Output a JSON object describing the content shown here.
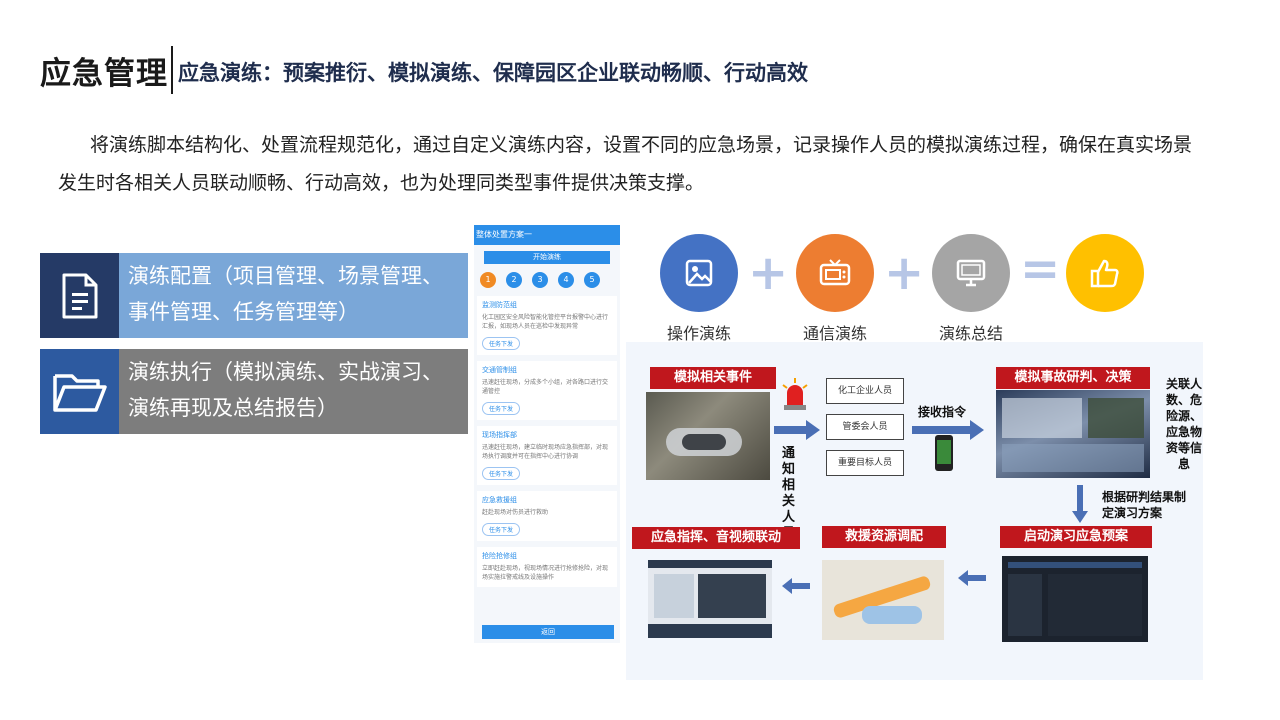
{
  "header": {
    "title": "应急管理",
    "subtitle": "应急演练：预案推衍、模拟演练、保障园区企业联动畅顺、行动高效"
  },
  "intro": "将演练脚本结构化、处置流程规范化，通过自定义演练内容，设置不同的应急场景，记录操作人员的模拟演练过程，确保在真实场景发生时各相关人员联动顺畅、行动高效，也为处理同类型事件提供决策支撑。",
  "features": [
    {
      "label": "演练配置（项目管理、场景管理、事件管理、任务管理等）",
      "icon": "document-icon"
    },
    {
      "label": "演练执行（模拟演练、实战演习、演练再现及总结报告）",
      "icon": "folder-icon"
    }
  ],
  "phone": {
    "header": "整体处置方案一",
    "start_button": "开始演练",
    "steps": [
      "1",
      "2",
      "3",
      "4",
      "5"
    ],
    "cards": [
      {
        "title": "监测防范组",
        "desc": "化工园区安全风险智能化管控平台报警中心进行汇报，如现场人员在巡检中发现异常",
        "button": "任务下发"
      },
      {
        "title": "交通管制组",
        "desc": "迅速赶往现场，分成多个小组，对各路口进行交通管控",
        "button": "任务下发"
      },
      {
        "title": "现场指挥部",
        "desc": "迅速赶往现场，建立临时现场应急指挥部，对现场执行调度并可在指挥中心进行协调",
        "button": "任务下发"
      },
      {
        "title": "应急救援组",
        "desc": "赶赴现场对伤员进行救助",
        "button": "任务下发"
      },
      {
        "title": "抢险抢修组",
        "desc": "立即赶赴现场，视现场情况进行抢修抢险，对现场实施拉警戒线及设施操作",
        "button": ""
      }
    ],
    "back_button": "返回"
  },
  "stages": [
    {
      "label": "操作演练",
      "color": "#4472c4",
      "icon": "image-icon"
    },
    {
      "label": "通信演练",
      "color": "#ed7d31",
      "icon": "tv-icon"
    },
    {
      "label": "演练总结",
      "color": "#a5a5a5",
      "icon": "monitor-icon"
    },
    {
      "label": "",
      "color": "#ffc000",
      "icon": "thumbs-up-icon"
    }
  ],
  "flow": {
    "tags": {
      "event": "模拟相关事件",
      "judge": "模拟事故研判、决策",
      "start": "启动演习应急预案",
      "resource": "救援资源调配",
      "command": "应急指挥、音视频联动"
    },
    "people": [
      "化工企业人员",
      "管委会人员",
      "重要目标人员"
    ],
    "notify": "通知相关人员",
    "receive": "接收指令",
    "related": "关联人数、危险源、应急物资等信息",
    "plan": "根据研判结果制定演习方案"
  }
}
